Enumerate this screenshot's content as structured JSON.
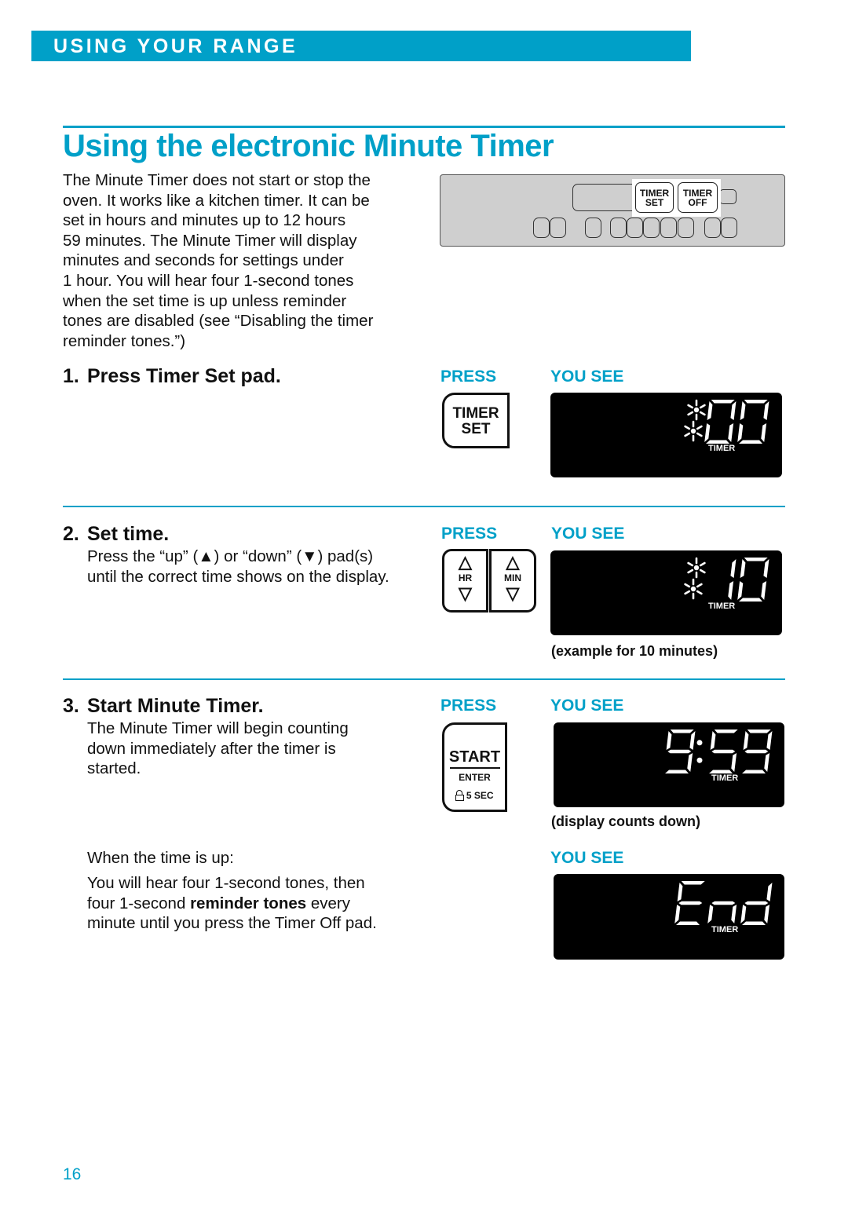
{
  "header": {
    "section_banner": "USING YOUR RANGE"
  },
  "page": {
    "title": "Using the electronic Minute Timer",
    "number": "16"
  },
  "intro": {
    "lines": [
      "The Minute Timer does not start or stop the",
      "oven. It works like a kitchen timer. It can be",
      "set in hours and minutes up to 12 hours",
      "59 minutes. The Minute Timer will display",
      "minutes and seconds for settings under",
      "1 hour. You will hear four 1-second tones",
      "when the set time is up unless reminder",
      "tones are disabled (see “Disabling the timer",
      "reminder tones.”)"
    ]
  },
  "control_panel": {
    "pads": [
      {
        "line1": "TIMER",
        "line2": "SET"
      },
      {
        "line1": "TIMER",
        "line2": "OFF"
      }
    ]
  },
  "labels": {
    "press": "PRESS",
    "you_see": "YOU SEE"
  },
  "steps": [
    {
      "number": "1.",
      "heading": "Press Timer Set pad.",
      "pad": {
        "line1": "TIMER",
        "line2": "SET"
      },
      "display": {
        "text": "00",
        "indicator": "TIMER",
        "blinking_icon": true
      }
    },
    {
      "number": "2.",
      "heading": "Set time.",
      "body": [
        "Press the “up” (▲) or “down” (▼) pad(s)",
        "until the correct time shows on the display."
      ],
      "pads": [
        {
          "label": "HR",
          "up": "△",
          "down": "▽"
        },
        {
          "label": "MIN",
          "up": "△",
          "down": "▽"
        }
      ],
      "display": {
        "text": "10",
        "indicator": "TIMER",
        "blinking_icon": true
      },
      "caption": "(example for 10 minutes)"
    },
    {
      "number": "3.",
      "heading": "Start Minute Timer.",
      "body": [
        "The Minute Timer will begin counting",
        "down immediately after the timer is",
        "started."
      ],
      "pad": {
        "line1": "START",
        "line2": "ENTER",
        "line3": "5 SEC",
        "lock_icon": "lock-icon"
      },
      "display": {
        "text": "9:59",
        "indicator": "TIMER"
      },
      "caption": "(display counts down)"
    }
  ],
  "time_up": {
    "label": "When the time is up:",
    "body_pre": "You will hear four 1-second tones, then",
    "body_line2_pre": "four 1-second ",
    "body_bold": "reminder tones",
    "body_line2_post": " every",
    "body_line3": "minute until you press the Timer Off pad.",
    "display": {
      "text": "End",
      "indicator": "TIMER"
    }
  },
  "colors": {
    "accent": "#00a0c8",
    "lcd_background": "#000000",
    "panel_gray": "#cfcfcf"
  }
}
